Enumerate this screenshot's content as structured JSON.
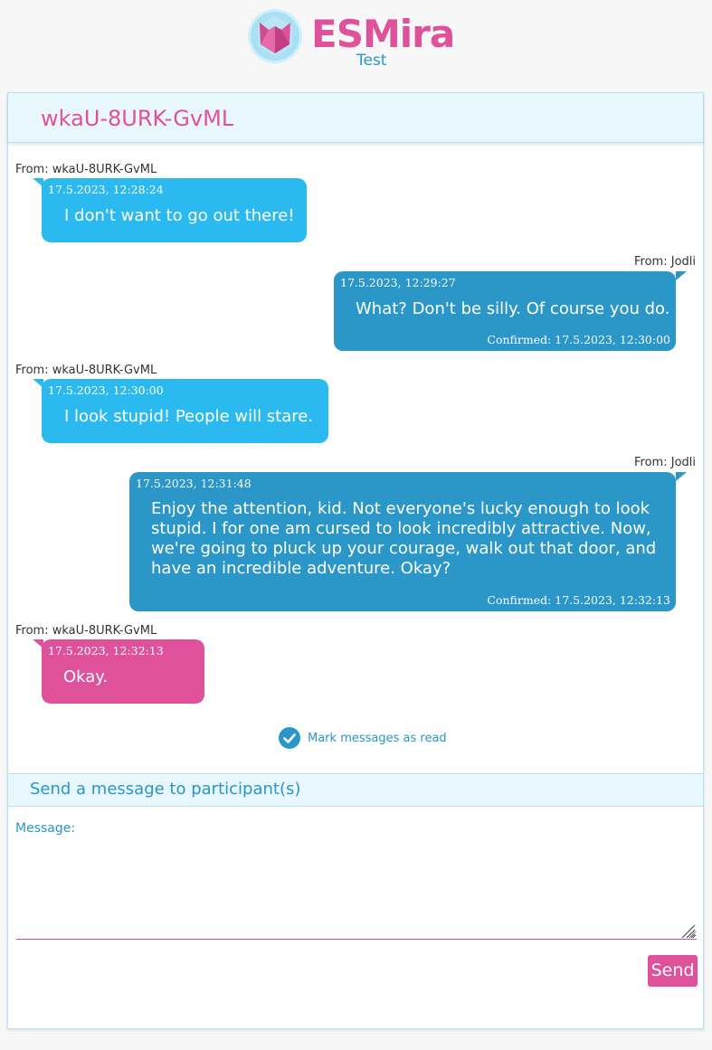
{
  "header": {
    "logo_text": "ESMira",
    "logo_sub": "Test"
  },
  "conversation": {
    "title": "wkaU-8URK-GvML",
    "messages": [
      {
        "from": "From: wkaU-8URK-GvML",
        "timestamp": "17.5.2023, 12:28:24",
        "text": "I don't want to go out there!",
        "direction": "incoming"
      },
      {
        "from": "From: Jodli",
        "timestamp": "17.5.2023, 12:29:27",
        "text": "What? Don't be silly. Of course you do.",
        "confirmed": "Confirmed: 17.5.2023, 12:30:00",
        "direction": "outgoing"
      },
      {
        "from": "From: wkaU-8URK-GvML",
        "timestamp": "17.5.2023, 12:30:00",
        "text": "I look stupid! People will stare.",
        "direction": "incoming"
      },
      {
        "from": "From: Jodli",
        "timestamp": "17.5.2023, 12:31:48",
        "text_lines": [
          "Enjoy the attention, kid. Not everyone's lucky enough to look",
          "stupid. I for one am cursed to look incredibly attractive. Now,",
          "we're going to pluck up your courage, walk out that door, and",
          "have an incredible adventure. Okay?"
        ],
        "confirmed": "Confirmed: 17.5.2023, 12:32:13",
        "direction": "outgoing"
      },
      {
        "from": "From: wkaU-8URK-GvML",
        "timestamp": "17.5.2023, 12:32:13",
        "text": "Okay.",
        "direction": "incoming",
        "unread": true
      }
    ],
    "mark_read_label": "Mark messages as read"
  },
  "send": {
    "title": "Send a message to participant(s)",
    "message_label": "Message:",
    "message_value": "",
    "button_label": "Send"
  },
  "colors": {
    "pink": "#e0519c",
    "blue": "#2a96c6",
    "incoming": "#2bbaf0",
    "outgoing": "#2b96c8",
    "header_bg": "#e8f7fc"
  },
  "icons": [
    "esmira-logo-icon",
    "check-circle-icon",
    "resize-grip-icon"
  ]
}
